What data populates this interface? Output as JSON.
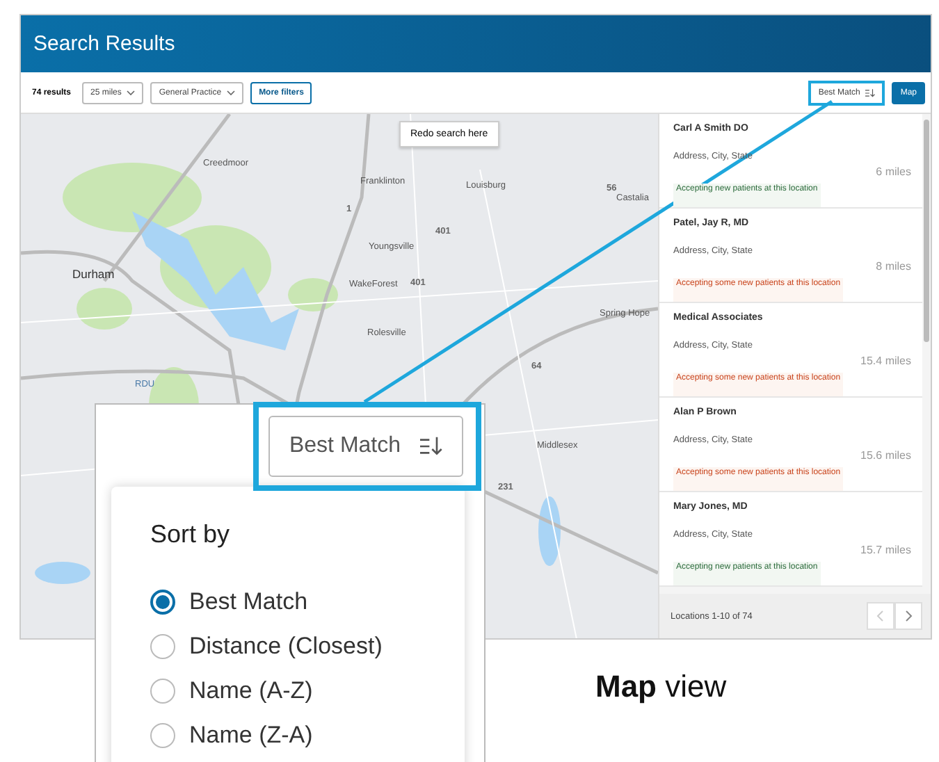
{
  "header": {
    "title": "Search Results"
  },
  "toolbar": {
    "result_count": "74 results",
    "filters": [
      {
        "label": "25 miles"
      },
      {
        "label": "General Practice"
      }
    ],
    "more_filters": "More filters",
    "sort": "Best Match",
    "view_button": "Map"
  },
  "map": {
    "redo_button": "Redo search here",
    "labels": [
      {
        "text": "Creedmoor",
        "kind": "place"
      },
      {
        "text": "Franklinton",
        "kind": "place"
      },
      {
        "text": "Louisburg",
        "kind": "place"
      },
      {
        "text": "56",
        "kind": "route"
      },
      {
        "text": "Castalia",
        "kind": "place"
      },
      {
        "text": "1",
        "kind": "route"
      },
      {
        "text": "401",
        "kind": "route"
      },
      {
        "text": "Youngsville",
        "kind": "place"
      },
      {
        "text": "Durham",
        "kind": "city"
      },
      {
        "text": "WakeForest",
        "kind": "place"
      },
      {
        "text": "401",
        "kind": "route"
      },
      {
        "text": "Spring Hope",
        "kind": "place"
      },
      {
        "text": "Rolesville",
        "kind": "place"
      },
      {
        "text": "64",
        "kind": "route"
      },
      {
        "text": "RDU",
        "kind": "airport"
      },
      {
        "text": "Middlesex",
        "kind": "place"
      },
      {
        "text": "231",
        "kind": "route"
      }
    ]
  },
  "results": [
    {
      "name": "Carl A Smith DO",
      "address": "Address, City, State",
      "distance": "6 miles",
      "acceptance": "Accepting new patients at this location",
      "kind": "accepting"
    },
    {
      "name": "Patel, Jay R, MD",
      "address": "Address, City, State",
      "distance": "8 miles",
      "acceptance": "Accepting some new patients at this location",
      "kind": "some"
    },
    {
      "name": "Medical Associates",
      "address": "Address, City, State",
      "distance": "15.4 miles",
      "acceptance": "Accepting some new patients at this location",
      "kind": "some"
    },
    {
      "name": "Alan P Brown",
      "address": "Address, City, State",
      "distance": "15.6 miles",
      "acceptance": "Accepting some new patients at this location",
      "kind": "some"
    },
    {
      "name": "Mary Jones, MD",
      "address": "Address, City, State",
      "distance": "15.7 miles",
      "acceptance": "Accepting new patients at this location",
      "kind": "accepting"
    }
  ],
  "pagination": {
    "summary": "Locations 1-10 of 74"
  },
  "callout": {
    "sort_button": "Best Match",
    "dropdown": {
      "title": "Sort by",
      "options": [
        {
          "label": "Best Match",
          "selected": true
        },
        {
          "label": "Distance (Closest)",
          "selected": false
        },
        {
          "label": "Name (A-Z)",
          "selected": false
        },
        {
          "label": "Name (Z-A)",
          "selected": false
        }
      ]
    }
  },
  "caption": "**Map** view"
}
